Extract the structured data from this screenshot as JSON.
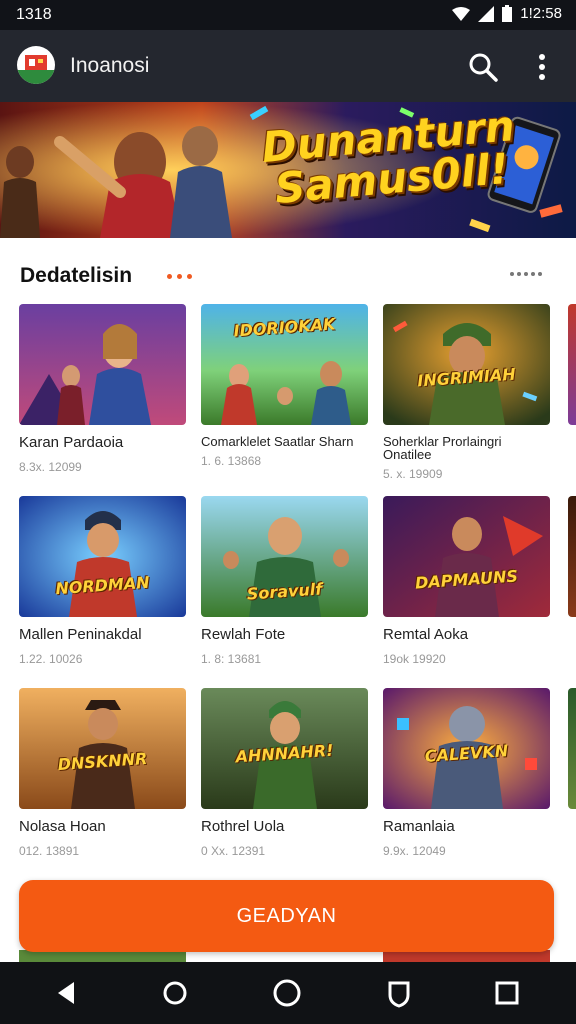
{
  "status_bar": {
    "time": "1318",
    "right_text": "1!2:58",
    "icons": [
      "wifi-icon",
      "signal-icon",
      "battery-icon"
    ]
  },
  "app_bar": {
    "title": "Inoanosi",
    "icons": [
      "app-logo",
      "search-icon",
      "more-vert-icon"
    ]
  },
  "banner": {
    "line1": "Dunanturn",
    "line2": "Samus0ll!"
  },
  "section": {
    "title": "Dedatelisin"
  },
  "games": [
    {
      "title": "Karan Pardaoia",
      "subtitle": "8.3x. 12099",
      "thumb_text": ""
    },
    {
      "title": "Comarklelet Saatlar Sharn",
      "subtitle": "1. 6. 13868",
      "thumb_text": "IDORIOKAK"
    },
    {
      "title": "Soherklar Prorlaingri Onatilee",
      "subtitle": "5. x. 19909",
      "thumb_text": "INGRIMIAH"
    },
    {
      "title": "Mallen Peninakdal",
      "subtitle": "1.22. 10026",
      "thumb_text": "NORDMAN"
    },
    {
      "title": "Rewlah Fote",
      "subtitle": "1. 8: 13681",
      "thumb_text": "Soravulf"
    },
    {
      "title": "Remtal Aoka",
      "subtitle": "19ok 19920",
      "thumb_text": "DAPMAUNS"
    },
    {
      "title": "Nolasa Hoan",
      "subtitle": "012. 13891",
      "thumb_text": "DNSKNNR"
    },
    {
      "title": "Rothrel Uola",
      "subtitle": "0 Xx. 12391",
      "thumb_text": "AHNNAHR!"
    },
    {
      "title": "Ramanlaia",
      "subtitle": "9.9x. 12049",
      "thumb_text": "CALEVKN"
    }
  ],
  "cta": {
    "label": "GEADYAN"
  },
  "colors": {
    "accent": "#f45a12",
    "app_bar": "#24272f",
    "status_bar": "#111318",
    "nav_bar": "#101215"
  },
  "nav_bar": {
    "icons": [
      "back-icon",
      "home-circle-icon",
      "home-icon",
      "shield-icon",
      "recents-icon"
    ]
  }
}
